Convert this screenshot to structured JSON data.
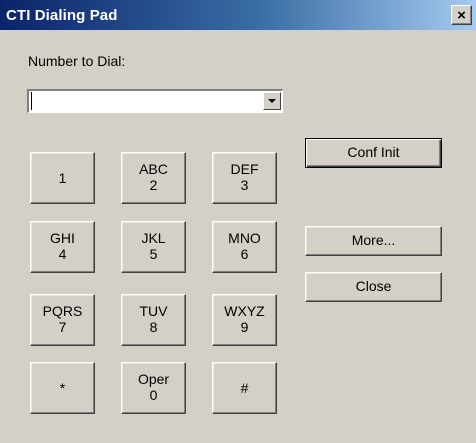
{
  "window": {
    "title": "CTI Dialing Pad",
    "close_glyph": "×"
  },
  "form": {
    "label": "Number to Dial:",
    "number_value": "",
    "dropdown_icon": "chevron-down-icon"
  },
  "keypad": {
    "k1": {
      "top": "",
      "bottom": "1"
    },
    "k2": {
      "top": "ABC",
      "bottom": "2"
    },
    "k3": {
      "top": "DEF",
      "bottom": "3"
    },
    "k4": {
      "top": "GHI",
      "bottom": "4"
    },
    "k5": {
      "top": "JKL",
      "bottom": "5"
    },
    "k6": {
      "top": "MNO",
      "bottom": "6"
    },
    "k7": {
      "top": "PQRS",
      "bottom": "7"
    },
    "k8": {
      "top": "TUV",
      "bottom": "8"
    },
    "k9": {
      "top": "WXYZ",
      "bottom": "9"
    },
    "kstar": {
      "top": "",
      "bottom": "*"
    },
    "k0": {
      "top": "Oper",
      "bottom": "0"
    },
    "khash": {
      "top": "",
      "bottom": "#"
    }
  },
  "buttons": {
    "conf_init": "Conf Init",
    "more": "More...",
    "close": "Close"
  }
}
